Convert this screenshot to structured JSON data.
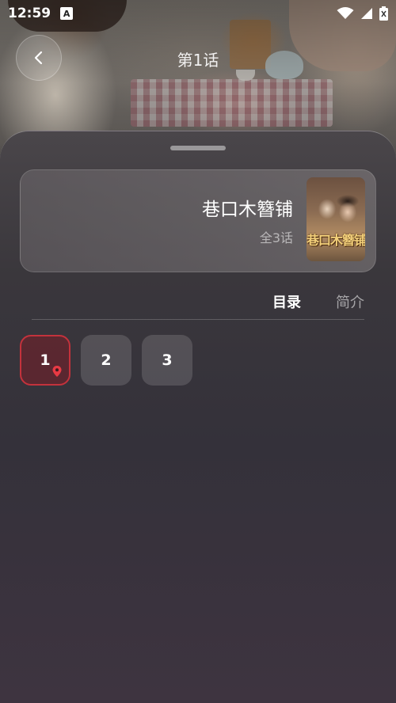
{
  "status_bar": {
    "time": "12:59",
    "notification_icon_label": "A"
  },
  "header": {
    "title": "第1话",
    "back_icon": "chevron-left-icon"
  },
  "book": {
    "title": "巷口木簪铺",
    "episode_count": "全3话",
    "cover_text": "巷口木簪铺"
  },
  "tabs": [
    {
      "label": "目录",
      "active": true
    },
    {
      "label": "简介",
      "active": false
    }
  ],
  "episodes": [
    {
      "label": "1",
      "current": true
    },
    {
      "label": "2",
      "current": false
    },
    {
      "label": "3",
      "current": false
    }
  ],
  "colors": {
    "accent": "#c3323c"
  }
}
